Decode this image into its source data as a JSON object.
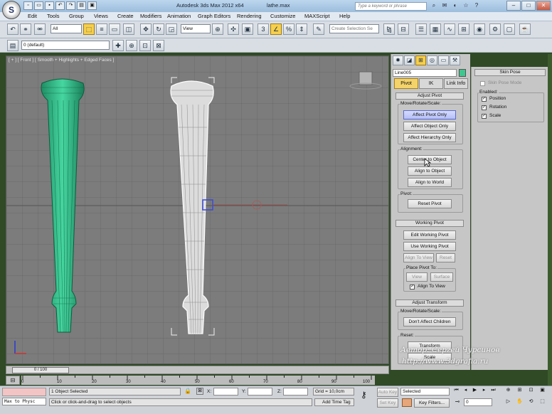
{
  "titlebar": {
    "app_title": "Autodesk 3ds Max  2012 x64",
    "file_name": "lathe.max",
    "search_placeholder": "Type a keyword or phrase"
  },
  "menu": [
    "Edit",
    "Tools",
    "Group",
    "Views",
    "Create",
    "Modifiers",
    "Animation",
    "Graph Editors",
    "Rendering",
    "Customize",
    "MAXScript",
    "Help"
  ],
  "toolbar": {
    "selection_filter": "All",
    "ref_coord": "View",
    "named_selection_placeholder": "Create Selection Se",
    "snap_label": "3",
    "layer": "0 (default)"
  },
  "viewport": {
    "label": "[ + ] [ Front ] [ Smooth + Highlights + Edged Faces ]"
  },
  "command_panel": {
    "object_name": "Line005",
    "object_color": "#3ec78f",
    "tabs": [
      "Pivot",
      "IK",
      "Link Info"
    ],
    "adjust_pivot": {
      "title": "Adjust Pivot",
      "move_rotate_scale": "Move/Rotate/Scale:",
      "affect_pivot_only": "Affect Pivot Only",
      "affect_object_only": "Affect Object Only",
      "affect_hierarchy_only": "Affect Hierarchy Only",
      "alignment": "Alignment:",
      "center_to_object": "Center to Object",
      "align_to_object": "Align to Object",
      "align_to_world": "Align to World",
      "pivot": "Pivot:",
      "reset_pivot": "Reset Pivot"
    },
    "working_pivot": {
      "title": "Working Pivot",
      "edit_working_pivot": "Edit Working Pivot",
      "use_working_pivot": "Use Working Pivot",
      "align_to_view": "Align To View",
      "reset": "Reset",
      "place_pivot_to": "Place Pivot To:",
      "view": "View",
      "surface": "Surface",
      "align_to_view_check": "Align To View"
    },
    "adjust_transform": {
      "title": "Adjust Transform",
      "move_rotate_scale": "Move/Rotate/Scale:",
      "dont_affect_children": "Don't Affect Children",
      "reset": "Reset:",
      "transform": "Transform",
      "scale": "Scale"
    }
  },
  "skin_pose": {
    "title": "Skin Pose",
    "skin_pose_mode": "Skin Pose Mode",
    "enabled": "Enabled:",
    "position": "Position",
    "rotation": "Rotation",
    "scale": "Scale"
  },
  "timeline": {
    "frame": "0 / 100",
    "ticks": [
      "0",
      "10",
      "20",
      "30",
      "40",
      "50",
      "60",
      "70",
      "80",
      "90",
      "100"
    ]
  },
  "status": {
    "maxscript": "Max to Physc",
    "objects_selected": "1 Object Selected",
    "prompt": "Click or click-and-drag to select objects",
    "x_label": "X:",
    "y_label": "Y:",
    "z_label": "Z:",
    "grid": "Grid = 10,0cm",
    "add_time_tag": "Add Time Tag",
    "auto_key": "Auto Key",
    "set_key": "Set Key",
    "key_mode": "Selected",
    "key_filters": "Key Filters...",
    "current_frame": "0"
  },
  "watermark": {
    "author": "Автор: Сергей Чурсинов",
    "site": "http://www.3dgrafia.ru"
  }
}
